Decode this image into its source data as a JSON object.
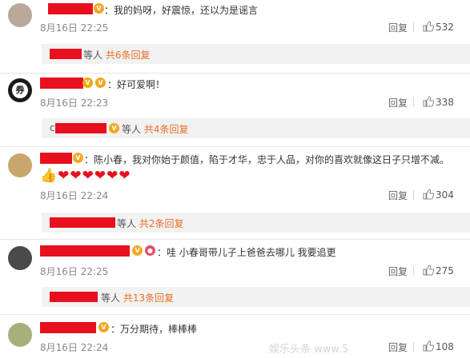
{
  "comments": [
    {
      "text": "：我的妈呀，好震惊，还以为是谣言",
      "date": "8月16日 22:25",
      "reply_label": "回复",
      "likes": "532",
      "replies_suffix": "等人",
      "replies_count": "共6条回复"
    },
    {
      "text": "：好可爱啊！",
      "date": "8月16日 22:23",
      "reply_label": "回复",
      "likes": "338",
      "replies_prefix": "c",
      "replies_suffix": "等人",
      "replies_count": "共4条回复"
    },
    {
      "text": "：陈小春，我对你始于颜值，陷于才华，忠于人品，对你的喜欢就像这日子只增不减。",
      "emoji": "👍❤❤❤❤❤❤",
      "date": "8月16日 22:24",
      "reply_label": "回复",
      "likes": "304",
      "replies_suffix": "等人",
      "replies_count": "共2条回复"
    },
    {
      "text": "：哇 小春哥带儿子上爸爸去哪儿 我要追更",
      "date": "8月16日 22:25",
      "reply_label": "回复",
      "likes": "275",
      "replies_suffix": "等人",
      "replies_count": "共13条回复"
    },
    {
      "text": "：万分期待，棒棒棒",
      "date": "8月16日 22:24",
      "reply_label": "回复",
      "likes": "108"
    }
  ],
  "avatar_badge": "券",
  "watermark": "娱乐头条 www.5"
}
